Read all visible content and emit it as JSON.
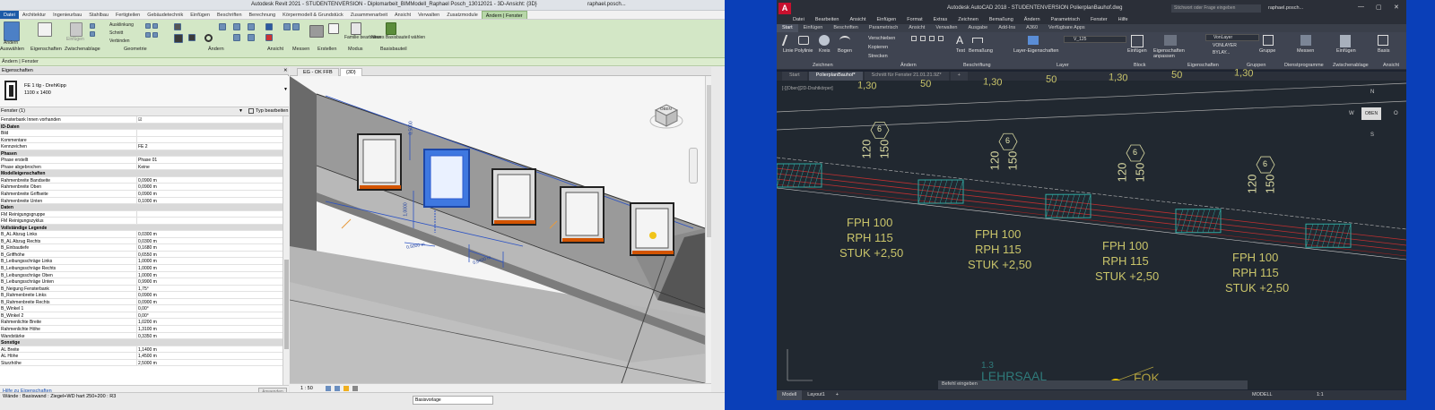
{
  "revit": {
    "title": "Autodesk Revit 2021 - STUDENTENVERSION - Diplomarbeit_BIMModell_Raphael Posch_13012021 - 3D-Ansicht: {3D}",
    "user": "raphael.posch...",
    "tabs": [
      "Datei",
      "Architektur",
      "Ingenieurbau",
      "Stahlbau",
      "Fertigteilen",
      "Gebäudetechnik",
      "Einfügen",
      "Beschriften",
      "Berechnung",
      "Körpermodell & Grundstück",
      "Zusammenarbeit",
      "Ansicht",
      "Verwalten",
      "Zusatzmodule",
      "Ändern | Fenster"
    ],
    "ribbon": {
      "modify": "Ändern",
      "select_label": "Auswählen",
      "properties_label": "Eigenschaften",
      "clipboard_label": "Zwischenablage",
      "geometry_label": "Geometrie",
      "modify_group_label": "Ändern",
      "view_label": "Ansicht",
      "measure_label": "Messen",
      "create_label": "Erstellen",
      "mode_label": "Modus",
      "basisbauteil_label": "Basisbauteil",
      "paste": "Einfügen",
      "cut": "Ausklinkung",
      "cut2": "Schnitt",
      "join": "Verbinden",
      "family_edit": "Familie bearbeiten",
      "new_host": "Neues Basisbauteil wählen"
    },
    "context_bar": "Ändern | Fenster",
    "properties": {
      "header": "Eigenschaften",
      "type_name": "FE 1 tlg - DrehKipp",
      "type_size": "1100 x 1400",
      "filter": "Fenster (1)",
      "edit_type": "Typ bearbeiten",
      "help": "Hilfe zu Eigenschaften",
      "apply": "Anwenden",
      "rows": [
        {
          "k": "Fensterbank Innen vorhanden",
          "v": "☑",
          "sec": false
        },
        {
          "k": "ID-Daten",
          "v": "",
          "sec": true
        },
        {
          "k": "Bild",
          "v": "",
          "sec": false
        },
        {
          "k": "Kommentare",
          "v": "",
          "sec": false
        },
        {
          "k": "Kennzeichen",
          "v": "FE 2",
          "sec": false
        },
        {
          "k": "Phasen",
          "v": "",
          "sec": true
        },
        {
          "k": "Phase erstellt",
          "v": "Phase 01",
          "sec": false
        },
        {
          "k": "Phase abgebrochen",
          "v": "Keine",
          "sec": false
        },
        {
          "k": "Modelleigenschaften",
          "v": "",
          "sec": true
        },
        {
          "k": "Rahmenbreite Bandseite",
          "v": "0,0900 m",
          "sec": false
        },
        {
          "k": "Rahmenbreite Oben",
          "v": "0,0900 m",
          "sec": false
        },
        {
          "k": "Rahmenbreite Griffseite",
          "v": "0,0900 m",
          "sec": false
        },
        {
          "k": "Rahmenbreite Unten",
          "v": "0,1000 m",
          "sec": false
        },
        {
          "k": "Daten",
          "v": "",
          "sec": true
        },
        {
          "k": "FM Reinigungsgruppe",
          "v": "",
          "sec": false
        },
        {
          "k": "FM Reinigungszyklus",
          "v": "",
          "sec": false
        },
        {
          "k": "Vollständige Legende",
          "v": "",
          "sec": true
        },
        {
          "k": "B_AL Abzug Links",
          "v": "0,0300 m",
          "sec": false
        },
        {
          "k": "B_AL Abzug Rechts",
          "v": "0,0300 m",
          "sec": false
        },
        {
          "k": "B_Einbautiefe",
          "v": "0,1680 m",
          "sec": false
        },
        {
          "k": "B_Griffhöhe",
          "v": "0,6550 m",
          "sec": false
        },
        {
          "k": "B_Leibungsschräge Links",
          "v": "1,0000 m",
          "sec": false
        },
        {
          "k": "B_Leibungsschräge Rechts",
          "v": "1,0000 m",
          "sec": false
        },
        {
          "k": "B_Leibungsschräge Oben",
          "v": "1,0000 m",
          "sec": false
        },
        {
          "k": "B_Leibungsschräge Unten",
          "v": "0,9900 m",
          "sec": false
        },
        {
          "k": "B_Neigung Fensterbank",
          "v": "1,75°",
          "sec": false
        },
        {
          "k": "B_Rahmenbreite Links",
          "v": "0,0900 m",
          "sec": false
        },
        {
          "k": "B_Rahmenbreite Rechts",
          "v": "0,0900 m",
          "sec": false
        },
        {
          "k": "B_Winkel 1",
          "v": "0,00°",
          "sec": false
        },
        {
          "k": "B_Winkel 2",
          "v": "0,00°",
          "sec": false
        },
        {
          "k": "Rahmenlichte Breite",
          "v": "1,0200 m",
          "sec": false
        },
        {
          "k": "Rahmenlichte Höhe",
          "v": "1,3100 m",
          "sec": false
        },
        {
          "k": "Wandstärke",
          "v": "0,3350 m",
          "sec": false
        },
        {
          "k": "Sonstige",
          "v": "",
          "sec": true
        },
        {
          "k": "AL Breite",
          "v": "1,1400 m",
          "sec": false
        },
        {
          "k": "AL Höhe",
          "v": "1,4500 m",
          "sec": false
        },
        {
          "k": "Sturzhöhe",
          "v": "2,5000 m",
          "sec": false
        }
      ]
    },
    "view_tabs": [
      "EG - OK FFB",
      "{3D}"
    ],
    "dims": [
      "0,5000 m",
      "1,0000",
      "0,6400 m",
      "0,5000"
    ],
    "viewcube_top": "OBEN",
    "scale": "1 : 50",
    "status": "Wände : Basiswand : Ziegel+WD hart 250+200 : R3",
    "status_select": "Basisvorlage"
  },
  "acad": {
    "title": "Autodesk AutoCAD 2018 - STUDENTENVERSION    PolierplanBauhof.dwg",
    "search": "Stichwort oder Frage eingeben",
    "user": "raphael.posch...",
    "menu": [
      "Datei",
      "Bearbeiten",
      "Ansicht",
      "Einfügen",
      "Format",
      "Extras",
      "Zeichnen",
      "Bemaßung",
      "Ändern",
      "Parametrisch",
      "Fenster",
      "Hilfe"
    ],
    "ribbon_tabs": [
      "Start",
      "Einfügen",
      "Beschriften",
      "Parametrisch",
      "Ansicht",
      "Verwalten",
      "Ausgabe",
      "Add-Ins",
      "A360",
      "Verfügbare Apps"
    ],
    "tools": {
      "line": "Linie",
      "polyline": "Polylinie",
      "circle": "Kreis",
      "arc": "Bogen",
      "move": "Verschieben",
      "copy": "Kopieren",
      "stretch": "Strecken",
      "text": "Text",
      "dim": "Bemaßung",
      "layer_props": "Layer-Eigenschaften",
      "insert": "Einfügen",
      "match_props": "Eigenschaften anpassen",
      "group": "Gruppe",
      "measure": "Messen",
      "paste": "Einfügen",
      "base": "Basis",
      "layer_name": "VonLayer",
      "layer_current": "V_125",
      "bylayer1": "VONLAYER",
      "bylayer2": "BYLAY..."
    },
    "groups": [
      "Zeichnen",
      "Ändern",
      "Beschriftung",
      "Layer",
      "Block",
      "Eigenschaften",
      "Gruppen",
      "Dienstprogramme",
      "Zwischenablage",
      "Ansicht"
    ],
    "file_tabs": [
      "Start",
      "PolierplanBauhof*",
      "Schnitt für Fenster 21.01.21.9Z*"
    ],
    "viewport_label": "[-][Oben][2D-Drahtkörper]",
    "dims_top": [
      "1,30",
      "50",
      "1,30",
      "50",
      "1,30",
      "50",
      "1,30"
    ],
    "bubble": "6",
    "heights": [
      "120",
      "150"
    ],
    "labels": [
      [
        "FPH 100",
        "RPH 115",
        "STUK +2,50"
      ]
    ],
    "room_num": "1.3",
    "room_name": "LEHRSAAL",
    "fok": "FOK",
    "compass": {
      "n": "N",
      "s": "S",
      "w": "W",
      "o": "O",
      "center": "OBEN"
    },
    "cmd": "Befehl eingeben",
    "layouts": [
      "Modell",
      "Layout1"
    ],
    "model_label": "MODELL",
    "zoom": "1:1"
  }
}
